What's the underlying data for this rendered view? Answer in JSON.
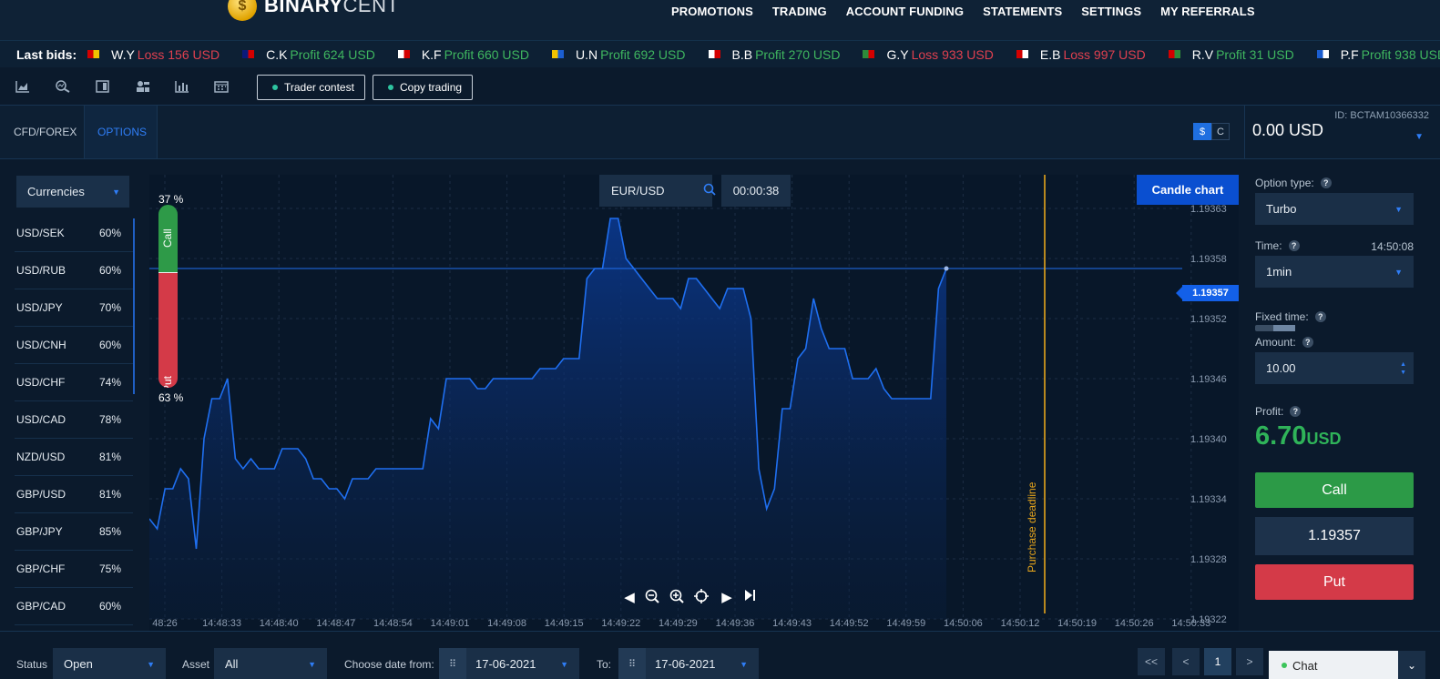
{
  "brand": {
    "bold": "BINARY",
    "light": "CENT"
  },
  "nav": [
    "PROMOTIONS",
    "TRADING",
    "ACCOUNT FUNDING",
    "STATEMENTS",
    "SETTINGS",
    "MY REFERRALS"
  ],
  "ticker": {
    "label": "Last bids:",
    "bids": [
      {
        "name": "W.Y",
        "status": "Loss",
        "amount": "156 USD",
        "flag": [
          "#d40000",
          "#f2c200"
        ]
      },
      {
        "name": "C.K",
        "status": "Profit",
        "amount": "624 USD",
        "flag": [
          "#0a1a7a",
          "#d40000"
        ]
      },
      {
        "name": "K.F",
        "status": "Profit",
        "amount": "660 USD",
        "flag": [
          "#ffffff",
          "#d40000"
        ]
      },
      {
        "name": "U.N",
        "status": "Profit",
        "amount": "692 USD",
        "flag": [
          "#f2c200",
          "#1b5ed1"
        ]
      },
      {
        "name": "B.B",
        "status": "Profit",
        "amount": "270 USD",
        "flag": [
          "#ffffff",
          "#d40000"
        ]
      },
      {
        "name": "G.Y",
        "status": "Loss",
        "amount": "933 USD",
        "flag": [
          "#2e8b3a",
          "#d40000"
        ]
      },
      {
        "name": "E.B",
        "status": "Loss",
        "amount": "997 USD",
        "flag": [
          "#d40000",
          "#ffffff"
        ]
      },
      {
        "name": "R.V",
        "status": "Profit",
        "amount": "31 USD",
        "flag": [
          "#d40000",
          "#2e8b3a"
        ]
      },
      {
        "name": "P.F",
        "status": "Profit",
        "amount": "938 USD",
        "flag": [
          "#1b5ed1",
          "#ffffff"
        ]
      }
    ]
  },
  "toolbar": {
    "icons": [
      "area-chart-icon",
      "zoom-analysis-icon",
      "layout-icon",
      "users-icon",
      "bar-chart-icon",
      "calendar-icon"
    ],
    "trader_contest": "Trader contest",
    "copy_trading": "Copy trading"
  },
  "tabs": {
    "cfd": "CFD/FOREX",
    "options": "OPTIONS"
  },
  "currency_switch": {
    "dollar": "$",
    "cent": "C"
  },
  "account": {
    "id": "ID: BCTAM10366332",
    "balance": "0.00 USD"
  },
  "category": "Currencies",
  "assets": [
    {
      "pair": "USD/SEK",
      "pct": "60%"
    },
    {
      "pair": "USD/RUB",
      "pct": "60%"
    },
    {
      "pair": "USD/JPY",
      "pct": "70%"
    },
    {
      "pair": "USD/CNH",
      "pct": "60%"
    },
    {
      "pair": "USD/CHF",
      "pct": "74%"
    },
    {
      "pair": "USD/CAD",
      "pct": "78%"
    },
    {
      "pair": "NZD/USD",
      "pct": "81%"
    },
    {
      "pair": "GBP/USD",
      "pct": "81%"
    },
    {
      "pair": "GBP/JPY",
      "pct": "85%"
    },
    {
      "pair": "GBP/CHF",
      "pct": "75%"
    },
    {
      "pair": "GBP/CAD",
      "pct": "60%"
    }
  ],
  "chart": {
    "symbol": "EUR/USD",
    "timer": "00:00:38",
    "candle_button": "Candle chart",
    "call_pct": "37 %",
    "put_pct": "63 %",
    "call_label": "Call",
    "put_label": "Put",
    "current_price": "1.19357",
    "deadline_label": "Purchase deadline",
    "deadline_time": "14:50:15",
    "colors": {
      "line": "#1f6ff0",
      "deadline": "#e5a41c"
    }
  },
  "chart_data": {
    "type": "area",
    "series": [
      {
        "values": [
          1.19332,
          1.19331,
          1.19335,
          1.19335,
          1.19337,
          1.19336,
          1.19329,
          1.1934,
          1.19344,
          1.19344,
          1.19346,
          1.19338,
          1.19337,
          1.19338,
          1.19337,
          1.19337,
          1.19337,
          1.19339,
          1.19339,
          1.19339,
          1.19338,
          1.19336,
          1.19336,
          1.19335,
          1.19335,
          1.19334,
          1.19336,
          1.19336,
          1.19336,
          1.19337,
          1.19337,
          1.19337,
          1.19337,
          1.19337,
          1.19337,
          1.19337,
          1.19342,
          1.19341,
          1.19346,
          1.19346,
          1.19346,
          1.19346,
          1.19345,
          1.19345,
          1.19346,
          1.19346,
          1.19346,
          1.19346,
          1.19346,
          1.19346,
          1.19347,
          1.19347,
          1.19347,
          1.19348,
          1.19348,
          1.19348,
          1.19356,
          1.19357,
          1.19357,
          1.19362,
          1.19362,
          1.19358,
          1.19357,
          1.19356,
          1.19355,
          1.19354,
          1.19354,
          1.19354,
          1.19353,
          1.19356,
          1.19356,
          1.19355,
          1.19354,
          1.19353,
          1.19355,
          1.19355,
          1.19355,
          1.19352,
          1.19337,
          1.19333,
          1.19335,
          1.19343,
          1.19343,
          1.19348,
          1.19349,
          1.19354,
          1.19351,
          1.19349,
          1.19349,
          1.19349,
          1.19346,
          1.19346,
          1.19346,
          1.19347,
          1.19345,
          1.19344,
          1.19344,
          1.19344,
          1.19344,
          1.19344,
          1.19344,
          1.19355,
          1.19357
        ]
      }
    ],
    "x_ticks": [
      "48:26",
      "14:48:33",
      "14:48:40",
      "14:48:47",
      "14:48:54",
      "14:49:01",
      "14:49:08",
      "14:49:15",
      "14:49:22",
      "14:49:29",
      "14:49:36",
      "14:49:43",
      "14:49:52",
      "14:49:59",
      "14:50:06",
      "14:50:12",
      "14:50:19",
      "14:50:26",
      "14:50:33"
    ],
    "y_ticks": [
      "1.19363",
      "1.19358",
      "1.19352",
      "1.19346",
      "1.19340",
      "1.19334",
      "1.19328",
      "1.19322"
    ],
    "ylim": [
      1.19322,
      1.19366
    ],
    "grid": true
  },
  "trade": {
    "option_type_label": "Option type:",
    "option_type": "Turbo",
    "time_label": "Time:",
    "server_time": "14:50:08",
    "duration": "1min",
    "fixed_time_label": "Fixed time:",
    "amount_label": "Amount:",
    "amount": "10.00",
    "profit_label": "Profit:",
    "profit_value": "6.70",
    "profit_unit": "USD",
    "call_button": "Call",
    "price": "1.19357",
    "put_button": "Put"
  },
  "filters": {
    "status_label": "Status",
    "status": "Open",
    "asset_label": "Asset",
    "asset": "All",
    "date_from_label": "Choose date from:",
    "date_from": "17-06-2021",
    "to_label": "To:",
    "date_to": "17-06-2021"
  },
  "pagination": {
    "first": "<<",
    "prev": "<",
    "current": "1",
    "next": ">"
  },
  "chat": {
    "label": "Chat"
  }
}
